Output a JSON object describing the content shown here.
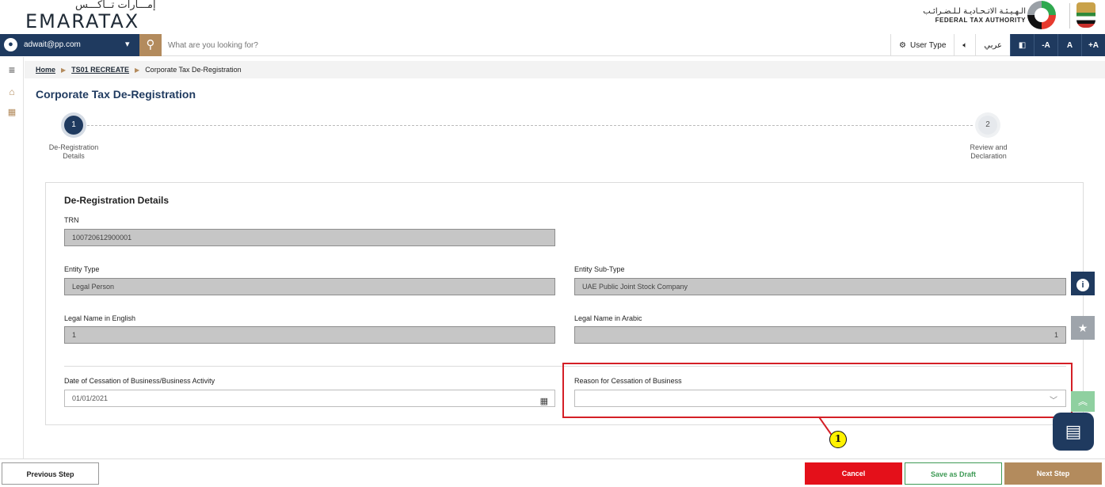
{
  "header": {
    "logo_ar": "إمـــارات تــاكـــس",
    "logo_en": "EMARATAX",
    "fta_ar": "الـهـيـئـة الاتـحـاديـة لـلـضـرائـب",
    "fta_en": "FEDERAL TAX AUTHORITY"
  },
  "navbar": {
    "user_email": "adwait@pp.com",
    "search_placeholder": "What are you looking for?",
    "user_type_label": "User Type",
    "language_label": "عربي",
    "font_decrease": "-A",
    "font_normal": "A",
    "font_increase": "+A"
  },
  "breadcrumb": {
    "home": "Home",
    "parent": "TS01 RECREATE",
    "current": "Corporate Tax De-Registration"
  },
  "page_title": "Corporate Tax De-Registration",
  "stepper": {
    "steps": [
      {
        "number": "1",
        "label_line1": "De-Registration",
        "label_line2": "Details",
        "state": "active"
      },
      {
        "number": "2",
        "label_line1": "Review and",
        "label_line2": "Declaration",
        "state": "pending"
      }
    ]
  },
  "form": {
    "section_title": "De-Registration Details",
    "trn_label": "TRN",
    "trn_value": "100720612900001",
    "entity_type_label": "Entity Type",
    "entity_type_value": "Legal Person",
    "entity_subtype_label": "Entity Sub-Type",
    "entity_subtype_value": "UAE Public Joint Stock Company",
    "legal_name_en_label": "Legal Name in English",
    "legal_name_en_value": "1",
    "legal_name_ar_label": "Legal Name in Arabic",
    "legal_name_ar_value": "1",
    "cessation_date_label": "Date of Cessation of Business/Business Activity",
    "cessation_date_value": "01/01/2021",
    "cessation_reason_label": "Reason for Cessation of Business",
    "cessation_reason_value": ""
  },
  "annotation": {
    "callout_number": "1"
  },
  "footer": {
    "previous_label": "Previous Step",
    "cancel_label": "Cancel",
    "draft_label": "Save as Draft",
    "next_label": "Next Step"
  },
  "colors": {
    "navy": "#1f3a5f",
    "gold": "#b38b5d",
    "cancel_red": "#e4101a",
    "draft_green": "#3e9a55",
    "highlight_red": "#d41f26"
  }
}
